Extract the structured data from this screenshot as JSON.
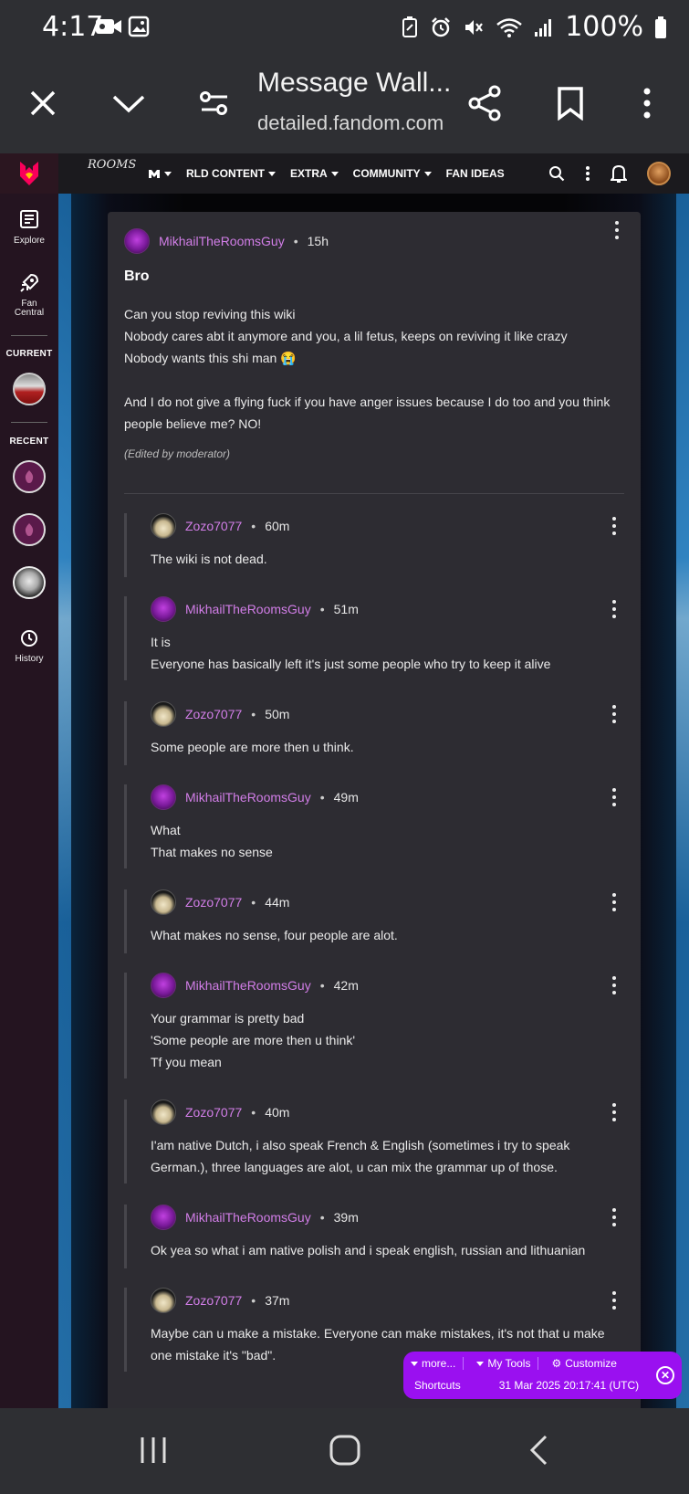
{
  "status_bar": {
    "time": "4:17",
    "battery": "100%"
  },
  "browser": {
    "title": "Message Wall...",
    "url": "detailed.fandom.com"
  },
  "wiki": {
    "wordmark_line1": "ROOMS",
    "nav": [
      "RLD CONTENT",
      "EXTRA",
      "COMMUNITY",
      "FAN IDEAS"
    ]
  },
  "sidebar": {
    "explore": "Explore",
    "fan_central": "Fan Central",
    "current_heading": "CURRENT",
    "recent_heading": "RECENT",
    "history": "History"
  },
  "post": {
    "author": "MikhailTheRoomsGuy",
    "time": "15h",
    "title": "Bro",
    "body1": "Can you stop reviving this wiki\nNobody cares abt it anymore and you, a lil fetus, keeps on reviving it like crazy\nNobody wants this shi man 😭",
    "body2": "And I do not give a flying fuck if you have anger issues because I do too and you think people believe me? NO!",
    "edited": "(Edited by moderator)"
  },
  "replies": [
    {
      "author": "Zozo7077",
      "time": "60m",
      "text": "The wiki is not dead."
    },
    {
      "author": "MikhailTheRoomsGuy",
      "time": "51m",
      "text": "It is\nEveryone has basically left it's just some people who try to keep it alive"
    },
    {
      "author": "Zozo7077",
      "time": "50m",
      "text": "Some people are more then u think."
    },
    {
      "author": "MikhailTheRoomsGuy",
      "time": "49m",
      "text": "What\nThat makes no sense"
    },
    {
      "author": "Zozo7077",
      "time": "44m",
      "text": "What makes no sense, four people are alot."
    },
    {
      "author": "MikhailTheRoomsGuy",
      "time": "42m",
      "text": "Your grammar is pretty bad\n'Some people are more then u think'\nTf you mean"
    },
    {
      "author": "Zozo7077",
      "time": "40m",
      "text": "I'am native Dutch, i also speak French & English (sometimes i try to speak German.), three languages are alot, u can mix the grammar up of those."
    },
    {
      "author": "MikhailTheRoomsGuy",
      "time": "39m",
      "text": "Ok yea so what i am native polish and i speak english, russian and lithuanian"
    },
    {
      "author": "Zozo7077",
      "time": "37m",
      "text": "Maybe can u make a mistake. Everyone can make mistakes, it's not that u make one mistake it's \"bad\"."
    }
  ],
  "toolbar": {
    "more": "more...",
    "my_tools": "My Tools",
    "customize": "Customize",
    "shortcuts": "Shortcuts",
    "timestamp": "31 Mar 2025 20:17:41 (UTC)"
  },
  "colors": {
    "username": "#d27ee8",
    "toolbar": "#9a10f0",
    "card": "#2d2c32"
  }
}
